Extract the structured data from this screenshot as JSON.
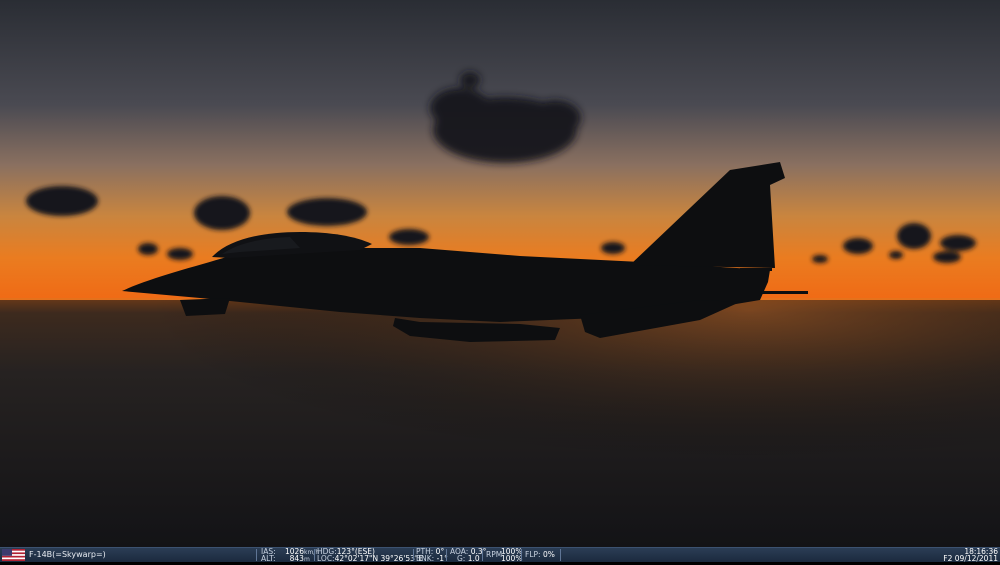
{
  "unit": {
    "name": "F-14B(=Skywarp=)",
    "flag_icon": "us-flag-icon"
  },
  "telemetry": {
    "ias_label": "IAS:",
    "ias_value": "1026",
    "ias_unit": "km/h",
    "alt_label": "ALT:",
    "alt_value": "843",
    "alt_unit": "m",
    "hdg_label": "HDG:",
    "hdg_value": "123°(ESE)",
    "loc_label": "LOC:",
    "loc_value": "42°02'17\"N  39°26'53\"E",
    "pth_label": "PTH:",
    "pth_value": "0°",
    "bnk_label": "BNK:",
    "bnk_value": "-1°",
    "aoa_label": "AOA:",
    "aoa_value": "0.3°",
    "g_label": "G:",
    "g_value": "1.0",
    "rpm_label": "RPM:",
    "rpm_value_1": "100%",
    "rpm_value_2": "100%",
    "flp_label": "FLP:",
    "flp_value": "0%"
  },
  "clock": {
    "time": "18:16:36",
    "date": "F2 09/12/2011"
  },
  "scene": {
    "subject": "aircraft-silhouette",
    "sky_top": "#2c2f36",
    "horizon_glow": "#e8761e",
    "sea": "#1a1714"
  }
}
